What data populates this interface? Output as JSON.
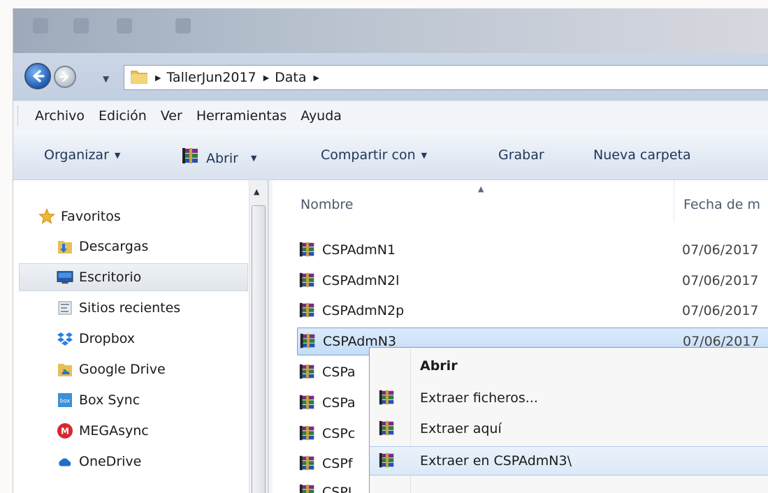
{
  "address_bar": {
    "crumbs": [
      "TallerJun2017",
      "Data"
    ]
  },
  "menu_bar": [
    "Archivo",
    "Edición",
    "Ver",
    "Herramientas",
    "Ayuda"
  ],
  "command_bar": {
    "organize": "Organizar",
    "open": "Abrir",
    "share": "Compartir con",
    "burn": "Grabar",
    "new_folder": "Nueva carpeta"
  },
  "nav_pane": {
    "favorites_label": "Favoritos",
    "items": [
      {
        "label": "Descargas",
        "icon": "downloads-folder-icon"
      },
      {
        "label": "Escritorio",
        "icon": "desktop-icon",
        "selected": true
      },
      {
        "label": "Sitios recientes",
        "icon": "recent-places-icon"
      },
      {
        "label": "Dropbox",
        "icon": "dropbox-icon"
      },
      {
        "label": "Google Drive",
        "icon": "google-drive-icon"
      },
      {
        "label": "Box Sync",
        "icon": "box-sync-icon"
      },
      {
        "label": "MEGAsync",
        "icon": "mega-icon"
      },
      {
        "label": "OneDrive",
        "icon": "onedrive-icon"
      }
    ],
    "box_icon_text": "box",
    "mega_icon_text": "M"
  },
  "file_list": {
    "columns": {
      "name": "Nombre",
      "date": "Fecha de m"
    },
    "files": [
      {
        "name": "CSPAdmN1",
        "date": "07/06/2017"
      },
      {
        "name": "CSPAdmN2l",
        "date": "07/06/2017"
      },
      {
        "name": "CSPAdmN2p",
        "date": "07/06/2017"
      },
      {
        "name": "CSPAdmN3",
        "date": "07/06/2017",
        "selected": true
      },
      {
        "name": "CSPa",
        "date": ""
      },
      {
        "name": "CSPa",
        "date": ""
      },
      {
        "name": "CSPc",
        "date": ""
      },
      {
        "name": "CSPf",
        "date": ""
      },
      {
        "name": "CSPI",
        "date": ""
      }
    ]
  },
  "context_menu": {
    "items": [
      {
        "label": "Abrir",
        "bold": true,
        "icon": ""
      },
      {
        "label": "Extraer ficheros...",
        "icon": "winrar-icon"
      },
      {
        "label": "Extraer aquí",
        "icon": "winrar-icon"
      },
      {
        "label": "Extraer en CSPAdmN3\\",
        "icon": "winrar-icon",
        "highlighted": true
      }
    ]
  },
  "colors": {
    "selection": "#c4ddf8",
    "command_text": "#1e3557",
    "accent_blue": "#1f5db8"
  }
}
